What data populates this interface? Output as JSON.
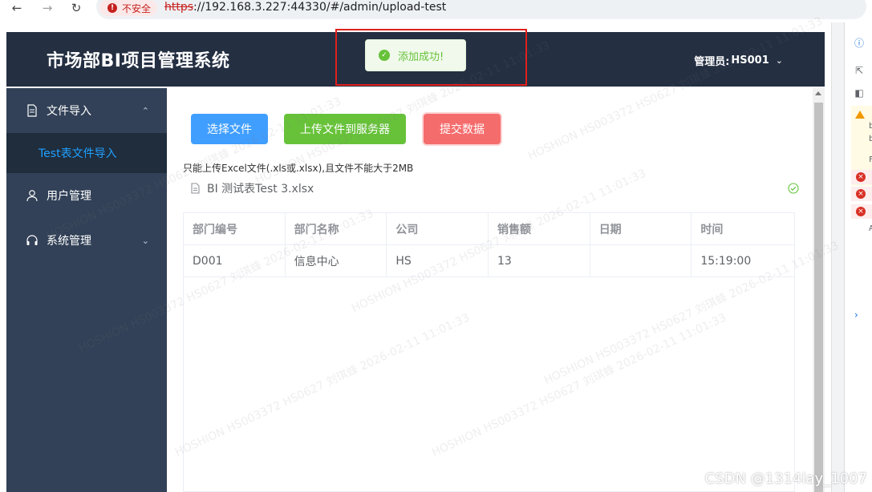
{
  "browser": {
    "back_icon": "arrow-left-icon",
    "forward_icon": "arrow-right-icon",
    "reload_icon": "reload-icon",
    "security_label": "不安全",
    "url_protocol": "https",
    "url_rest": "://192.168.3.227:44330/#/admin/upload-test"
  },
  "header": {
    "title": "市场部BI项目管理系统",
    "user_label": "管理员:",
    "user_name": "HS001",
    "background": "#242f42"
  },
  "sidebar": {
    "background": "#324157",
    "items": [
      {
        "label": "文件导入",
        "icon": "document-icon",
        "expanded": true
      },
      {
        "label": "用户管理",
        "icon": "user-icon"
      },
      {
        "label": "系统管理",
        "icon": "headset-icon",
        "expanded": false
      }
    ],
    "submenu": [
      {
        "label": "Test表文件导入",
        "active": true
      }
    ]
  },
  "toolbar": {
    "choose_label": "选择文件",
    "upload_label": "上传文件到服务器",
    "submit_label": "提交数据",
    "colors": {
      "primary": "#409eff",
      "success": "#67c23a",
      "danger": "#f56c6c"
    }
  },
  "upload": {
    "hint": "只能上传Excel文件(.xls或.xlsx),且文件不能大于2MB",
    "file_name": "BI 测试表Test 3.xlsx",
    "status_icon": "check-circle-icon"
  },
  "table": {
    "columns": [
      "部门编号",
      "部门名称",
      "公司",
      "销售额",
      "日期",
      "时间"
    ],
    "rows": [
      [
        "D001",
        "信息中心",
        "HS",
        "13",
        "",
        "15:19:00"
      ]
    ]
  },
  "toast": {
    "message": "添加成功!",
    "type": "success",
    "color": "#67c23a"
  },
  "watermark": {
    "lines": [
      "HOSHION HS003372 HS0627 刘琪蜂 2026-02-11 11:01:33"
    ]
  },
  "footer": {
    "credit": "CSDN @1314lay_1007"
  }
}
